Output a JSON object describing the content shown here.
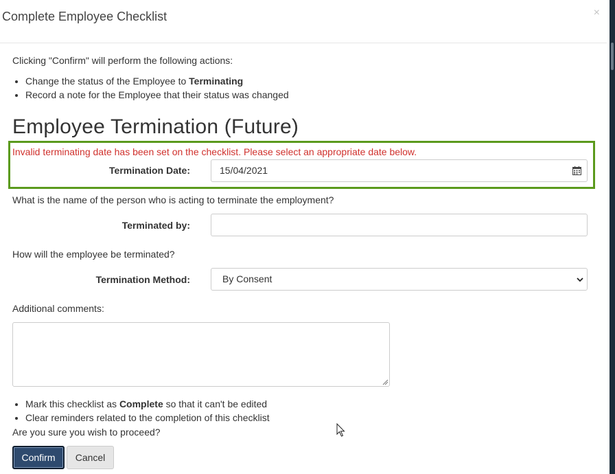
{
  "modal": {
    "title": "Complete Employee Checklist",
    "close_label": "×"
  },
  "intro": {
    "text": "Clicking \"Confirm\" will perform the following actions:",
    "action1_prefix": "Change the status of the Employee to ",
    "action1_bold": "Terminating",
    "action2": "Record a note for the Employee that their status was changed"
  },
  "section": {
    "heading": "Employee Termination (Future)"
  },
  "termination_date": {
    "error": "Invalid terminating date has been set on the checklist. Please select an appropriate date below.",
    "label": "Termination Date:",
    "value": "15/04/2021",
    "icon": "calendar-icon"
  },
  "terminated_by": {
    "question": "What is the name of the person who is acting to terminate the employment?",
    "label": "Terminated by:",
    "value": ""
  },
  "termination_method": {
    "question": "How will the employee be terminated?",
    "label": "Termination Method:",
    "selected": "By Consent"
  },
  "comments": {
    "label": "Additional comments:",
    "value": ""
  },
  "summary": {
    "item1_prefix": "Mark this checklist as ",
    "item1_bold": "Complete",
    "item1_suffix": " so that it can't be edited",
    "item2": "Clear reminders related to the completion of this checklist",
    "proceed": "Are you sure you wish to proceed?"
  },
  "buttons": {
    "confirm": "Confirm",
    "cancel": "Cancel"
  },
  "colors": {
    "error": "#d0312d",
    "highlight": "#5b9a1d",
    "confirm_bg": "#2e4a6e"
  }
}
